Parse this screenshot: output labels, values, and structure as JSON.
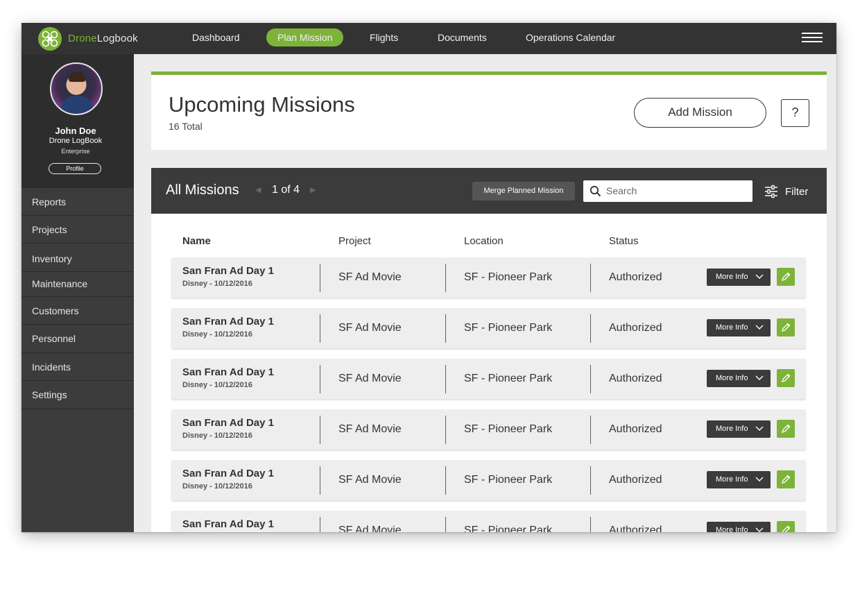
{
  "brand": {
    "name_accent": "Drone",
    "name_rest": "Logbook"
  },
  "nav": {
    "items": [
      {
        "label": "Dashboard",
        "active": false
      },
      {
        "label": "Plan Mission",
        "active": true
      },
      {
        "label": "Flights",
        "active": false
      },
      {
        "label": "Documents",
        "active": false
      },
      {
        "label": "Operations Calendar",
        "active": false
      }
    ],
    "menu_icon": "hamburger-menu-icon"
  },
  "profile": {
    "name": "John Doe",
    "organization": "Drone LogBook",
    "plan": "Enterprise",
    "button_label": "Profile"
  },
  "sidebar": {
    "items": [
      {
        "label": "Reports"
      },
      {
        "label": "Projects"
      },
      {
        "label": "Inventory"
      },
      {
        "label": "Maintenance"
      },
      {
        "label": "Customers"
      },
      {
        "label": "Personnel"
      },
      {
        "label": "Incidents"
      },
      {
        "label": "Settings"
      }
    ]
  },
  "header": {
    "title": "Upcoming Missions",
    "total": "16 Total",
    "add_button": "Add Mission",
    "help_button": "?"
  },
  "list": {
    "title": "All Missions",
    "pager": "1 of 4",
    "merge_button": "Merge Planned Mission",
    "search_placeholder": "Search",
    "filter_label": "Filter",
    "columns": {
      "name": "Name",
      "project": "Project",
      "location": "Location",
      "status": "Status"
    },
    "more_label": "More Info",
    "rows": [
      {
        "name": "San Fran Ad Day 1",
        "sub": "Disney - 10/12/2016",
        "project": "SF Ad Movie",
        "location": "SF - Pioneer Park",
        "status": "Authorized"
      },
      {
        "name": "San Fran Ad Day 1",
        "sub": "Disney - 10/12/2016",
        "project": "SF Ad Movie",
        "location": "SF - Pioneer Park",
        "status": "Authorized"
      },
      {
        "name": "San Fran Ad Day 1",
        "sub": "Disney - 10/12/2016",
        "project": "SF Ad Movie",
        "location": "SF - Pioneer Park",
        "status": "Authorized"
      },
      {
        "name": "San Fran Ad Day 1",
        "sub": "Disney - 10/12/2016",
        "project": "SF Ad Movie",
        "location": "SF - Pioneer Park",
        "status": "Authorized"
      },
      {
        "name": "San Fran Ad Day 1",
        "sub": "Disney - 10/12/2016",
        "project": "SF Ad Movie",
        "location": "SF - Pioneer Park",
        "status": "Authorized"
      },
      {
        "name": "San Fran Ad Day 1",
        "sub": "",
        "project": "SF Ad Movie",
        "location": "SF - Pioneer Park",
        "status": "Authorized"
      }
    ]
  },
  "colors": {
    "accent": "#7db339",
    "topbar": "#333333",
    "sidebar": "#3c3c3c",
    "list_header": "#3b3b3b"
  },
  "icons": [
    "drone-logo-icon",
    "hamburger-menu-icon",
    "search-icon",
    "filter-sliders-icon",
    "chevron-down-icon",
    "pencil-edit-icon",
    "pager-prev-arrow-icon",
    "pager-next-arrow-icon"
  ]
}
